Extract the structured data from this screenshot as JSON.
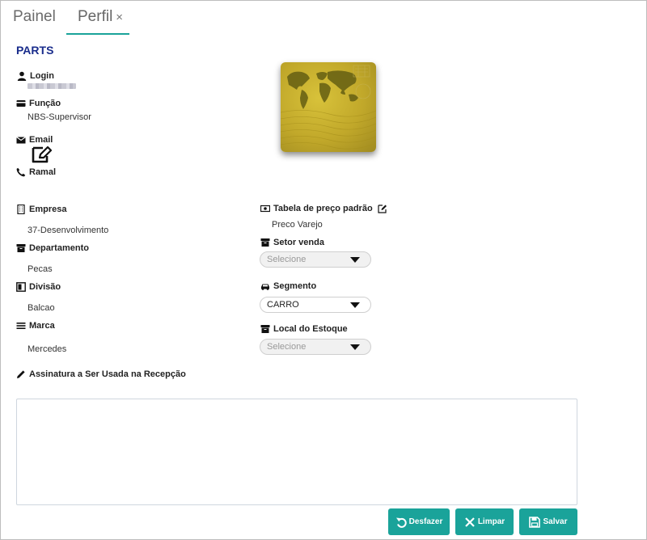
{
  "tabs": [
    {
      "label": "Painel"
    },
    {
      "label": "Perfil",
      "close": "×"
    }
  ],
  "title": "PARTS",
  "profile": {
    "login_label": "Login",
    "funcao_label": "Função",
    "funcao_value": "NBS-Supervisor",
    "email_label": "Email",
    "ramal_label": "Ramal"
  },
  "org": {
    "empresa_label": "Empresa",
    "empresa_value": "37-Desenvolvimento",
    "departamento_label": "Departamento",
    "departamento_value": "Pecas",
    "divisao_label": "Divisão",
    "divisao_value": "Balcao",
    "marca_label": "Marca",
    "marca_value": "Mercedes"
  },
  "right": {
    "tabela_label": "Tabela de preço padrão",
    "tabela_value": "Preco Varejo",
    "setor_label": "Setor venda",
    "setor_value": "Selecione",
    "segmento_label": "Segmento",
    "segmento_value": "CARRO",
    "local_label": "Local do Estoque",
    "local_value": "Selecione"
  },
  "signature_label": "Assinatura a Ser Usada na Recepção",
  "buttons": {
    "desfazer": "Desfazer",
    "limpar": "Limpar",
    "salvar": "Salvar"
  },
  "colors": {
    "accent": "#1aa39a",
    "title": "#1a2d8c"
  },
  "icons": [
    "user-icon",
    "id-card-icon",
    "envelope-icon",
    "edit-icon",
    "phone-icon",
    "building-icon",
    "archive-icon",
    "division-icon",
    "list-icon",
    "pencil-icon",
    "money-icon",
    "car-icon",
    "undo-icon",
    "close-icon",
    "save-icon"
  ]
}
